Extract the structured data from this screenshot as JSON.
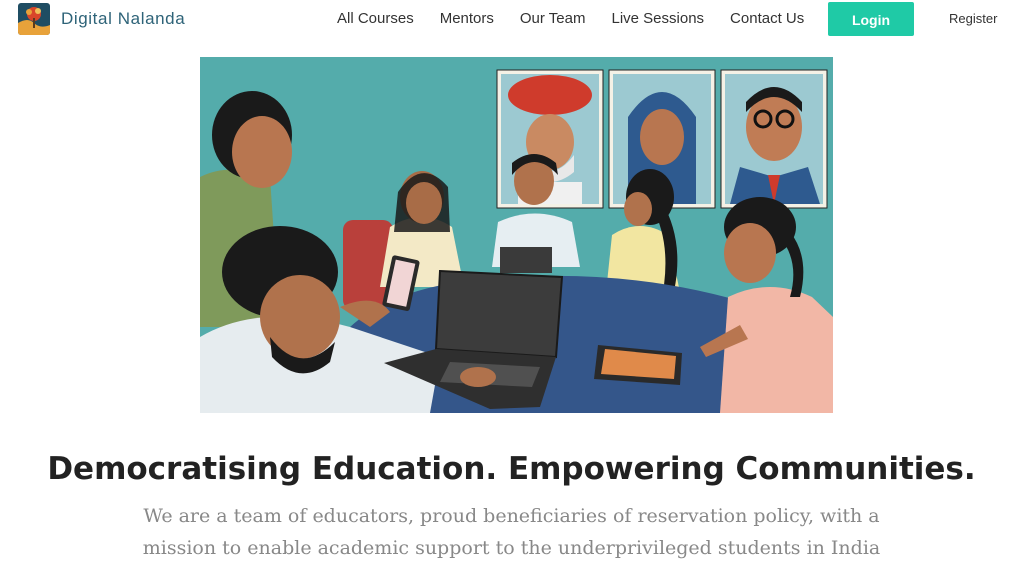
{
  "brand": {
    "name": "Digital Nalanda",
    "logo": "tree-logo-icon"
  },
  "nav": {
    "items": [
      "All Courses",
      "Mentors",
      "Our Team",
      "Live Sessions",
      "Contact Us"
    ],
    "login_label": "Login",
    "register_label": "Register"
  },
  "hero": {
    "image": "illustration-classroom-meeting",
    "portraits": [
      "portrait-turbaned-man",
      "portrait-woman",
      "portrait-man-glasses"
    ]
  },
  "content": {
    "headline": "Democratising Education. Empowering Communities.",
    "subtext": "We are a team of educators, proud beneficiaries of reservation policy, with a mission to enable academic support to the underprivileged students in India"
  },
  "colors": {
    "accent": "#1fcaa6",
    "brand_text": "#2e6378",
    "headline": "#222222",
    "subtext": "#888888",
    "hero_wall": "#4fa8a8",
    "table": "#34568a"
  }
}
